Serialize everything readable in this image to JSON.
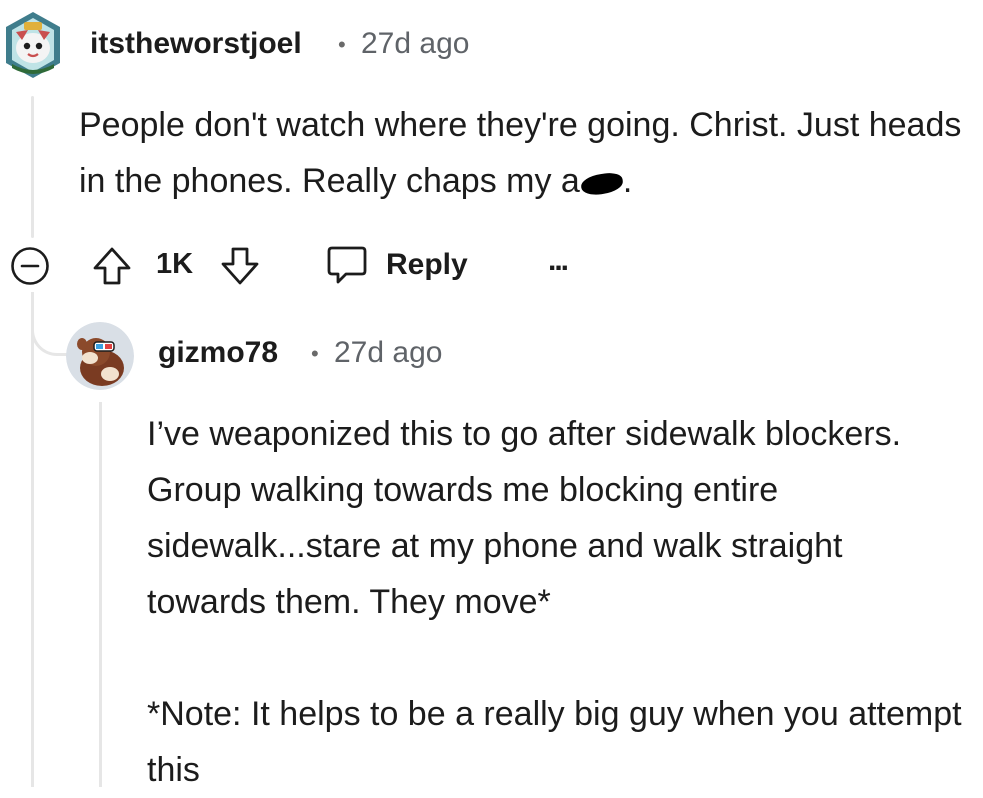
{
  "comment": {
    "author": "itstheworstjoel",
    "separator": "•",
    "time": "27d ago",
    "body": "People don't watch where they're going. Christ. Just heads in the phones. Really chaps my a",
    "score": "1K",
    "reply_label": "Reply",
    "more_label": "..."
  },
  "reply": {
    "author": "gizmo78",
    "separator": "•",
    "time": "27d ago",
    "paragraphs": [
      "I’ve weaponized this to go after sidewalk blockers. Group walking towards me blocking entire sidewalk...stare at my phone and walk straight towards them. They move*",
      "*Note: It helps to be a really big guy when you attempt this"
    ]
  },
  "colors": {
    "text": "#1c1c1c",
    "meta": "#5f6368",
    "thread_line": "#e6e6e6"
  },
  "icons": {
    "collapse": "collapse-icon",
    "upvote": "upvote-arrow-icon",
    "downvote": "downvote-arrow-icon",
    "reply": "speech-bubble-icon",
    "more": "more-dots-icon"
  }
}
